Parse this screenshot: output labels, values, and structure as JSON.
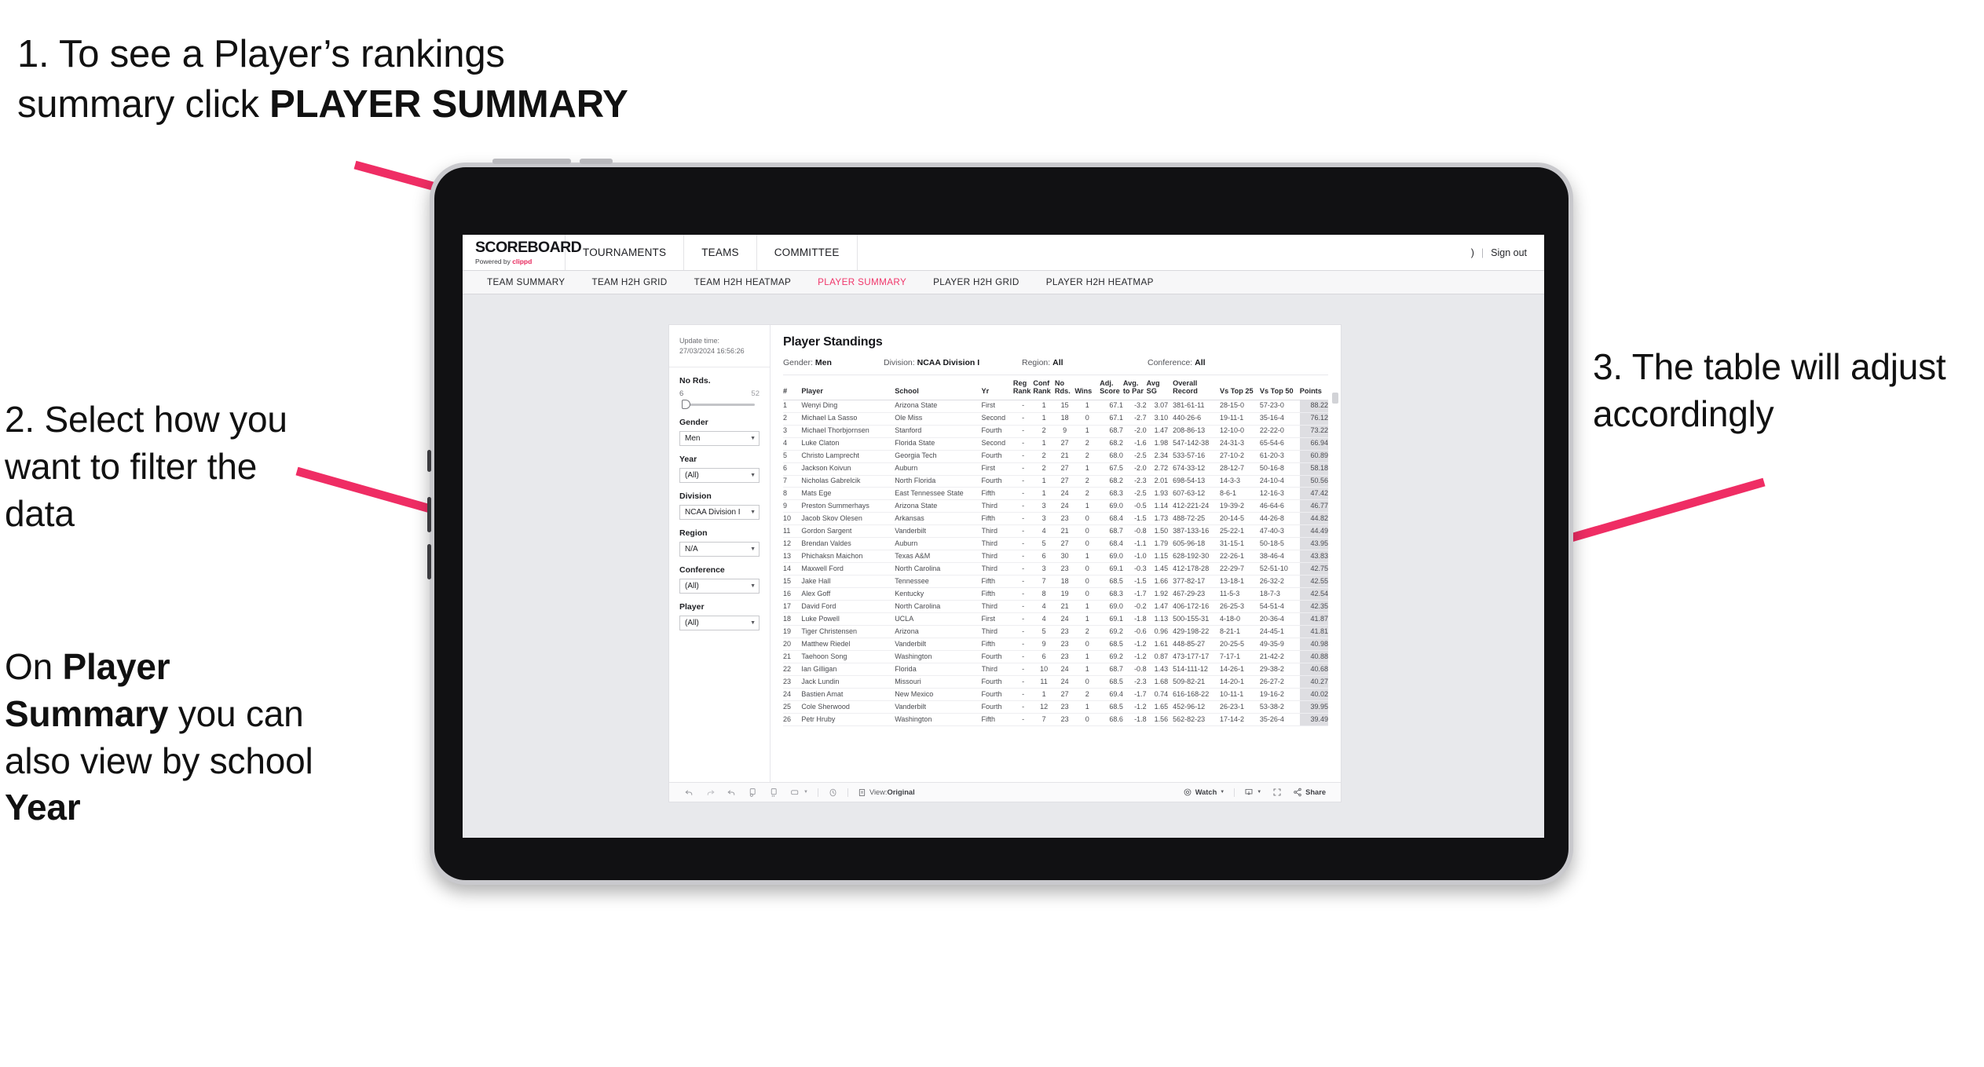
{
  "annotations": {
    "step1_prefix": "1. To see a Player’s rankings summary click ",
    "step1_bold": "PLAYER SUMMARY",
    "step2": "2. Select how you want to filter the data",
    "step2b_p1": "On ",
    "step2b_b1": "Player Summary",
    "step2b_p2": " you can also view by school ",
    "step2b_b2": "Year",
    "step3": "3. The table will adjust accordingly"
  },
  "app": {
    "brand_name": "SCOREBOARD",
    "brand_sub_prefix": "Powered by ",
    "brand_sub_accent": "clippd",
    "top_nav": [
      "TOURNAMENTS",
      "TEAMS",
      "COMMITTEE"
    ],
    "account_glyph": ")",
    "separator": "|",
    "sign_out": "Sign out",
    "accent_color": "#f0366a",
    "tabs": [
      {
        "label": "TEAM SUMMARY",
        "active": false
      },
      {
        "label": "TEAM H2H GRID",
        "active": false
      },
      {
        "label": "TEAM H2H HEATMAP",
        "active": false
      },
      {
        "label": "PLAYER SUMMARY",
        "active": true
      },
      {
        "label": "PLAYER H2H GRID",
        "active": false
      },
      {
        "label": "PLAYER H2H HEATMAP",
        "active": false
      }
    ]
  },
  "filters": {
    "update_label": "Update time:",
    "update_value": "27/03/2024 16:56:26",
    "slider": {
      "label": "No Rds.",
      "min": "6",
      "max": "52"
    },
    "selects": [
      {
        "label": "Gender",
        "value": "Men"
      },
      {
        "label": "Year",
        "value": "(All)"
      },
      {
        "label": "Division",
        "value": "NCAA Division I"
      },
      {
        "label": "Region",
        "value": "N/A"
      },
      {
        "label": "Conference",
        "value": "(All)"
      },
      {
        "label": "Player",
        "value": "(All)"
      }
    ],
    "caret": "▼"
  },
  "standings": {
    "title": "Player Standings",
    "meta": [
      {
        "key": "Gender: ",
        "val": "Men"
      },
      {
        "key": "Division: ",
        "val": "NCAA Division I"
      },
      {
        "key": "Region: ",
        "val": "All"
      },
      {
        "key": "Conference: ",
        "val": "All"
      }
    ],
    "columns": [
      {
        "id": "num",
        "l1": "#",
        "l2": ""
      },
      {
        "id": "play",
        "l1": "Player",
        "l2": ""
      },
      {
        "id": "school",
        "l1": "School",
        "l2": ""
      },
      {
        "id": "yr",
        "l1": "Yr",
        "l2": ""
      },
      {
        "id": "reg",
        "l1": "Reg",
        "l2": "Rank"
      },
      {
        "id": "conf",
        "l1": "Conf",
        "l2": "Rank"
      },
      {
        "id": "rds",
        "l1": "No",
        "l2": "Rds."
      },
      {
        "id": "wins",
        "l1": "Wins",
        "l2": ""
      },
      {
        "id": "adj",
        "l1": "Adj.",
        "l2": "Score"
      },
      {
        "id": "par",
        "l1": "Avg.",
        "l2": "to Par"
      },
      {
        "id": "sg",
        "l1": "Avg",
        "l2": "SG"
      },
      {
        "id": "rec",
        "l1": "Overall",
        "l2": "Record"
      },
      {
        "id": "t25",
        "l1": "Vs Top 25",
        "l2": ""
      },
      {
        "id": "t50",
        "l1": "Vs Top 50",
        "l2": ""
      },
      {
        "id": "pts",
        "l1": "Points",
        "l2": ""
      }
    ],
    "rows": [
      [
        "1",
        "Wenyi Ding",
        "Arizona State",
        "First",
        "-",
        "1",
        "15",
        "1",
        "67.1",
        "-3.2",
        "3.07",
        "381-61-11",
        "28-15-0",
        "57-23-0",
        "88.22"
      ],
      [
        "2",
        "Michael La Sasso",
        "Ole Miss",
        "Second",
        "-",
        "1",
        "18",
        "0",
        "67.1",
        "-2.7",
        "3.10",
        "440-26-6",
        "19-11-1",
        "35-16-4",
        "76.12"
      ],
      [
        "3",
        "Michael Thorbjornsen",
        "Stanford",
        "Fourth",
        "-",
        "2",
        "9",
        "1",
        "68.7",
        "-2.0",
        "1.47",
        "208-86-13",
        "12-10-0",
        "22-22-0",
        "73.22"
      ],
      [
        "4",
        "Luke Claton",
        "Florida State",
        "Second",
        "-",
        "1",
        "27",
        "2",
        "68.2",
        "-1.6",
        "1.98",
        "547-142-38",
        "24-31-3",
        "65-54-6",
        "66.94"
      ],
      [
        "5",
        "Christo Lamprecht",
        "Georgia Tech",
        "Fourth",
        "-",
        "2",
        "21",
        "2",
        "68.0",
        "-2.5",
        "2.34",
        "533-57-16",
        "27-10-2",
        "61-20-3",
        "60.89"
      ],
      [
        "6",
        "Jackson Koivun",
        "Auburn",
        "First",
        "-",
        "2",
        "27",
        "1",
        "67.5",
        "-2.0",
        "2.72",
        "674-33-12",
        "28-12-7",
        "50-16-8",
        "58.18"
      ],
      [
        "7",
        "Nicholas Gabrelcik",
        "North Florida",
        "Fourth",
        "-",
        "1",
        "27",
        "2",
        "68.2",
        "-2.3",
        "2.01",
        "698-54-13",
        "14-3-3",
        "24-10-4",
        "50.56"
      ],
      [
        "8",
        "Mats Ege",
        "East Tennessee State",
        "Fifth",
        "-",
        "1",
        "24",
        "2",
        "68.3",
        "-2.5",
        "1.93",
        "607-63-12",
        "8-6-1",
        "12-16-3",
        "47.42"
      ],
      [
        "9",
        "Preston Summerhays",
        "Arizona State",
        "Third",
        "-",
        "3",
        "24",
        "1",
        "69.0",
        "-0.5",
        "1.14",
        "412-221-24",
        "19-39-2",
        "46-64-6",
        "46.77"
      ],
      [
        "10",
        "Jacob Skov Olesen",
        "Arkansas",
        "Fifth",
        "-",
        "3",
        "23",
        "0",
        "68.4",
        "-1.5",
        "1.73",
        "488-72-25",
        "20-14-5",
        "44-26-8",
        "44.82"
      ],
      [
        "11",
        "Gordon Sargent",
        "Vanderbilt",
        "Third",
        "-",
        "4",
        "21",
        "0",
        "68.7",
        "-0.8",
        "1.50",
        "387-133-16",
        "25-22-1",
        "47-40-3",
        "44.49"
      ],
      [
        "12",
        "Brendan Valdes",
        "Auburn",
        "Third",
        "-",
        "5",
        "27",
        "0",
        "68.4",
        "-1.1",
        "1.79",
        "605-96-18",
        "31-15-1",
        "50-18-5",
        "43.95"
      ],
      [
        "13",
        "Phichaksn Maichon",
        "Texas A&M",
        "Third",
        "-",
        "6",
        "30",
        "1",
        "69.0",
        "-1.0",
        "1.15",
        "628-192-30",
        "22-26-1",
        "38-46-4",
        "43.83"
      ],
      [
        "14",
        "Maxwell Ford",
        "North Carolina",
        "Third",
        "-",
        "3",
        "23",
        "0",
        "69.1",
        "-0.3",
        "1.45",
        "412-178-28",
        "22-29-7",
        "52-51-10",
        "42.75"
      ],
      [
        "15",
        "Jake Hall",
        "Tennessee",
        "Fifth",
        "-",
        "7",
        "18",
        "0",
        "68.5",
        "-1.5",
        "1.66",
        "377-82-17",
        "13-18-1",
        "26-32-2",
        "42.55"
      ],
      [
        "16",
        "Alex Goff",
        "Kentucky",
        "Fifth",
        "-",
        "8",
        "19",
        "0",
        "68.3",
        "-1.7",
        "1.92",
        "467-29-23",
        "11-5-3",
        "18-7-3",
        "42.54"
      ],
      [
        "17",
        "David Ford",
        "North Carolina",
        "Third",
        "-",
        "4",
        "21",
        "1",
        "69.0",
        "-0.2",
        "1.47",
        "406-172-16",
        "26-25-3",
        "54-51-4",
        "42.35"
      ],
      [
        "18",
        "Luke Powell",
        "UCLA",
        "First",
        "-",
        "4",
        "24",
        "1",
        "69.1",
        "-1.8",
        "1.13",
        "500-155-31",
        "4-18-0",
        "20-36-4",
        "41.87"
      ],
      [
        "19",
        "Tiger Christensen",
        "Arizona",
        "Third",
        "-",
        "5",
        "23",
        "2",
        "69.2",
        "-0.6",
        "0.96",
        "429-198-22",
        "8-21-1",
        "24-45-1",
        "41.81"
      ],
      [
        "20",
        "Matthew Riedel",
        "Vanderbilt",
        "Fifth",
        "-",
        "9",
        "23",
        "0",
        "68.5",
        "-1.2",
        "1.61",
        "448-85-27",
        "20-25-5",
        "49-35-9",
        "40.98"
      ],
      [
        "21",
        "Taehoon Song",
        "Washington",
        "Fourth",
        "-",
        "6",
        "23",
        "1",
        "69.2",
        "-1.2",
        "0.87",
        "473-177-17",
        "7-17-1",
        "21-42-2",
        "40.88"
      ],
      [
        "22",
        "Ian Gilligan",
        "Florida",
        "Third",
        "-",
        "10",
        "24",
        "1",
        "68.7",
        "-0.8",
        "1.43",
        "514-111-12",
        "14-26-1",
        "29-38-2",
        "40.68"
      ],
      [
        "23",
        "Jack Lundin",
        "Missouri",
        "Fourth",
        "-",
        "11",
        "24",
        "0",
        "68.5",
        "-2.3",
        "1.68",
        "509-82-21",
        "14-20-1",
        "26-27-2",
        "40.27"
      ],
      [
        "24",
        "Bastien Amat",
        "New Mexico",
        "Fourth",
        "-",
        "1",
        "27",
        "2",
        "69.4",
        "-1.7",
        "0.74",
        "616-168-22",
        "10-11-1",
        "19-16-2",
        "40.02"
      ],
      [
        "25",
        "Cole Sherwood",
        "Vanderbilt",
        "Fourth",
        "-",
        "12",
        "23",
        "1",
        "68.5",
        "-1.2",
        "1.65",
        "452-96-12",
        "26-23-1",
        "53-38-2",
        "39.95"
      ],
      [
        "26",
        "Petr Hruby",
        "Washington",
        "Fifth",
        "-",
        "7",
        "23",
        "0",
        "68.6",
        "-1.8",
        "1.56",
        "562-82-23",
        "17-14-2",
        "35-26-4",
        "39.49"
      ]
    ]
  },
  "toolbar": {
    "view_label": "View: ",
    "view_value": "Original",
    "watch_label": "Watch",
    "share_label": "Share",
    "caret": "▼"
  }
}
